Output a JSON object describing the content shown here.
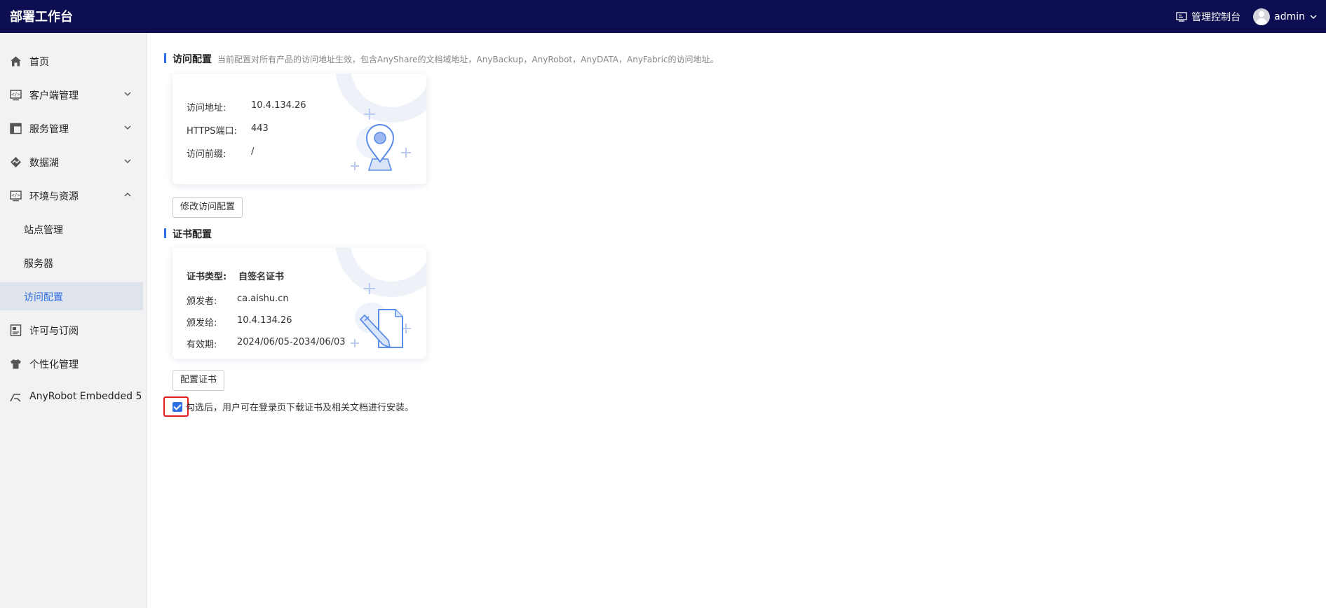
{
  "header": {
    "brand": "部署工作台",
    "console_label": "管理控制台",
    "user_name": "admin"
  },
  "sidebar": {
    "items": [
      {
        "label": "首页",
        "icon": "home-icon"
      },
      {
        "label": "客户端管理",
        "icon": "client-code-icon"
      },
      {
        "label": "服务管理",
        "icon": "layout-icon"
      },
      {
        "label": "数据湖",
        "icon": "datalake-icon"
      },
      {
        "label": "环境与资源",
        "icon": "environment-icon"
      },
      {
        "label": "站点管理"
      },
      {
        "label": "服务器"
      },
      {
        "label": "访问配置"
      },
      {
        "label": "许可与订阅",
        "icon": "license-icon"
      },
      {
        "label": "个性化管理",
        "icon": "shirt-icon"
      },
      {
        "label": "AnyRobot Embedded 5",
        "icon": "anyrobot-icon"
      }
    ],
    "active": "访问配置"
  },
  "access": {
    "title": "访问配置",
    "desc": "当前配置对所有产品的访问地址生效，包含AnyShare的文档域地址，AnyBackup，AnyRobot，AnyDATA，AnyFabric的访问地址。",
    "address_label": "访问地址:",
    "address_value": "10.4.134.26",
    "port_label": "HTTPS端口:",
    "port_value": "443",
    "prefix_label": "访问前缀:",
    "prefix_value": "/",
    "edit_button": "修改访问配置"
  },
  "cert": {
    "title": "证书配置",
    "type_label": "证书类型:",
    "type_value": "自签名证书",
    "issuer_label": "颁发者:",
    "issuer_value": "ca.aishu.cn",
    "issued_to_label": "颁发给:",
    "issued_to_value": "10.4.134.26",
    "validity_label": "有效期:",
    "validity_value": "2024/06/05-2034/06/03",
    "config_button": "配置证书",
    "checkbox_label": "勾选后，用户可在登录页下载证书及相关文档进行安装。",
    "checkbox_checked": true
  },
  "colors": {
    "topbar": "#0c0e51",
    "accent": "#2f6fe4",
    "highlight_border": "#e02020"
  }
}
